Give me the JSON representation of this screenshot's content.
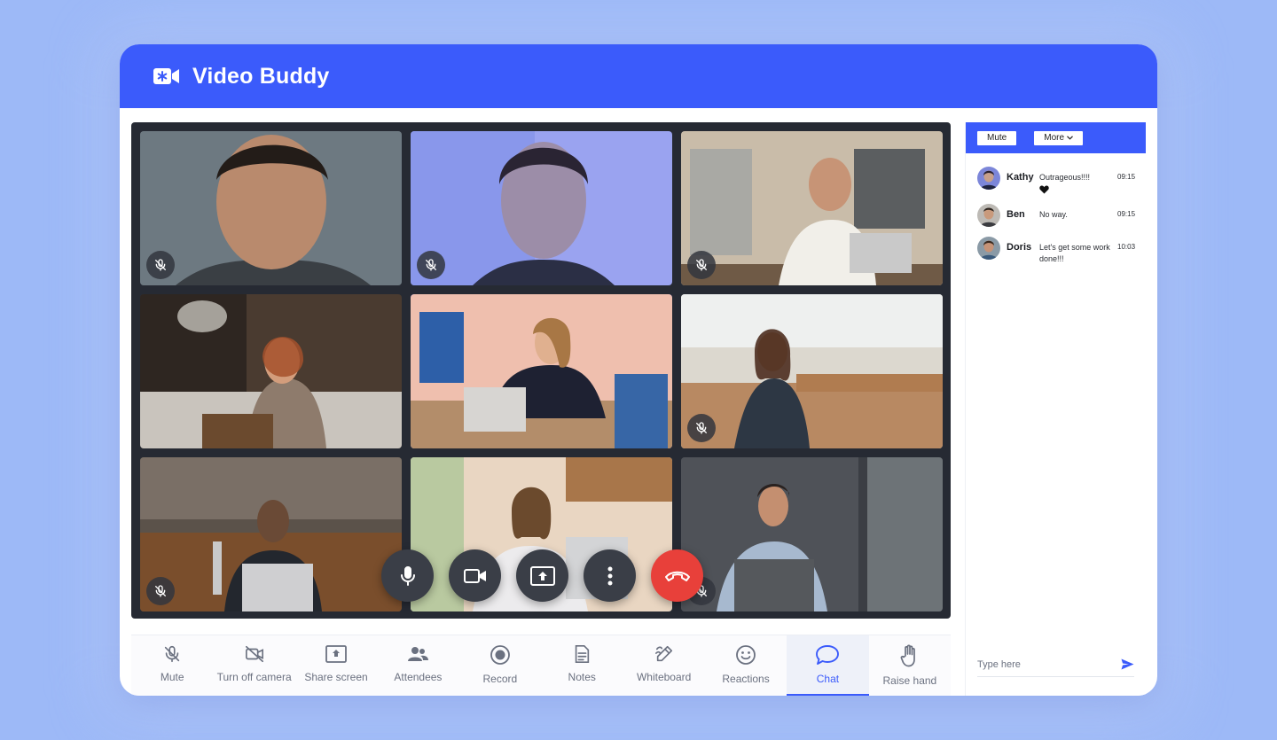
{
  "app": {
    "title": "Video Buddy",
    "logo_icon": "video-camera-star-icon",
    "brand_color": "#3b5bfb"
  },
  "participants": [
    {
      "id": "p1",
      "muted": true,
      "active": false
    },
    {
      "id": "p2",
      "muted": true,
      "active": false
    },
    {
      "id": "p3",
      "muted": true,
      "active": false
    },
    {
      "id": "p4",
      "muted": false,
      "active": false
    },
    {
      "id": "p5",
      "muted": false,
      "active": true
    },
    {
      "id": "p6",
      "muted": true,
      "active": false
    },
    {
      "id": "p7",
      "muted": true,
      "active": false
    },
    {
      "id": "p8",
      "muted": false,
      "active": false
    },
    {
      "id": "p9",
      "muted": true,
      "active": false
    }
  ],
  "call_controls": [
    {
      "name": "mic-control",
      "icon": "microphone-icon"
    },
    {
      "name": "camera-control",
      "icon": "video-camera-icon"
    },
    {
      "name": "share-control",
      "icon": "share-screen-icon"
    },
    {
      "name": "more-control",
      "icon": "vertical-dots-icon"
    },
    {
      "name": "end-call",
      "icon": "hang-up-icon",
      "color": "#e8403a"
    }
  ],
  "toolbar": {
    "items": [
      {
        "label": "Mute",
        "icon": "mic-off-icon"
      },
      {
        "label": "Turn off camera",
        "icon": "camera-off-icon"
      },
      {
        "label": "Share screen",
        "icon": "share-screen-icon"
      },
      {
        "label": "Attendees",
        "icon": "people-icon"
      },
      {
        "label": "Record",
        "icon": "record-icon"
      },
      {
        "label": "Notes",
        "icon": "notes-icon"
      },
      {
        "label": "Whiteboard",
        "icon": "whiteboard-pen-icon"
      },
      {
        "label": "Reactions",
        "icon": "smiley-icon"
      },
      {
        "label": "Chat",
        "icon": "chat-bubble-icon",
        "selected": true
      },
      {
        "label": "Raise hand",
        "icon": "hand-icon"
      }
    ]
  },
  "chat": {
    "mute_label": "Mute",
    "more_label": "More",
    "messages": [
      {
        "name": "Kathy",
        "text": "Outrageous!!!!",
        "reaction": "heart-icon",
        "time": "09:15"
      },
      {
        "name": "Ben",
        "text": "No way.",
        "time": "09:15"
      },
      {
        "name": "Doris",
        "text": "Let's get some work done!!!",
        "time": "10:03"
      }
    ],
    "input_placeholder": "Type here",
    "send_icon": "send-arrow-icon"
  }
}
